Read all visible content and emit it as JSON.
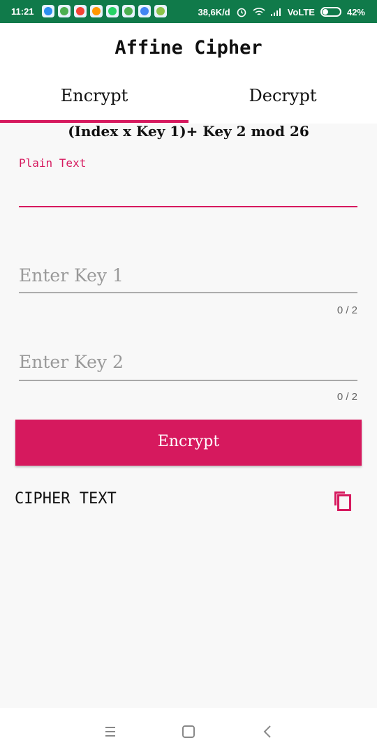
{
  "status_bar": {
    "time": "11:21",
    "network_speed": "38,6K/d",
    "network_type": "VoLTE",
    "battery": "42%"
  },
  "app": {
    "title": "Affine Cipher"
  },
  "tabs": [
    {
      "label": "Encrypt",
      "selected": true
    },
    {
      "label": "Decrypt",
      "selected": false
    }
  ],
  "formula": "(Index x Key 1)+ Key 2 mod 26",
  "plain_text_field": {
    "label": "Plain Text",
    "value": ""
  },
  "key1_field": {
    "placeholder": "Enter Key 1",
    "counter": "0 / 2"
  },
  "key2_field": {
    "placeholder": "Enter Key 2",
    "counter": "0 / 2"
  },
  "encrypt_button": {
    "label": "Encrypt"
  },
  "cipher_text": {
    "label": "CIPHER TEXT"
  },
  "colors": {
    "accent": "#d6195e",
    "status_bar": "#107a4a"
  },
  "icons": {
    "copy": "copy-icon",
    "menu": "menu-icon",
    "home": "home-icon",
    "back": "back-icon"
  }
}
